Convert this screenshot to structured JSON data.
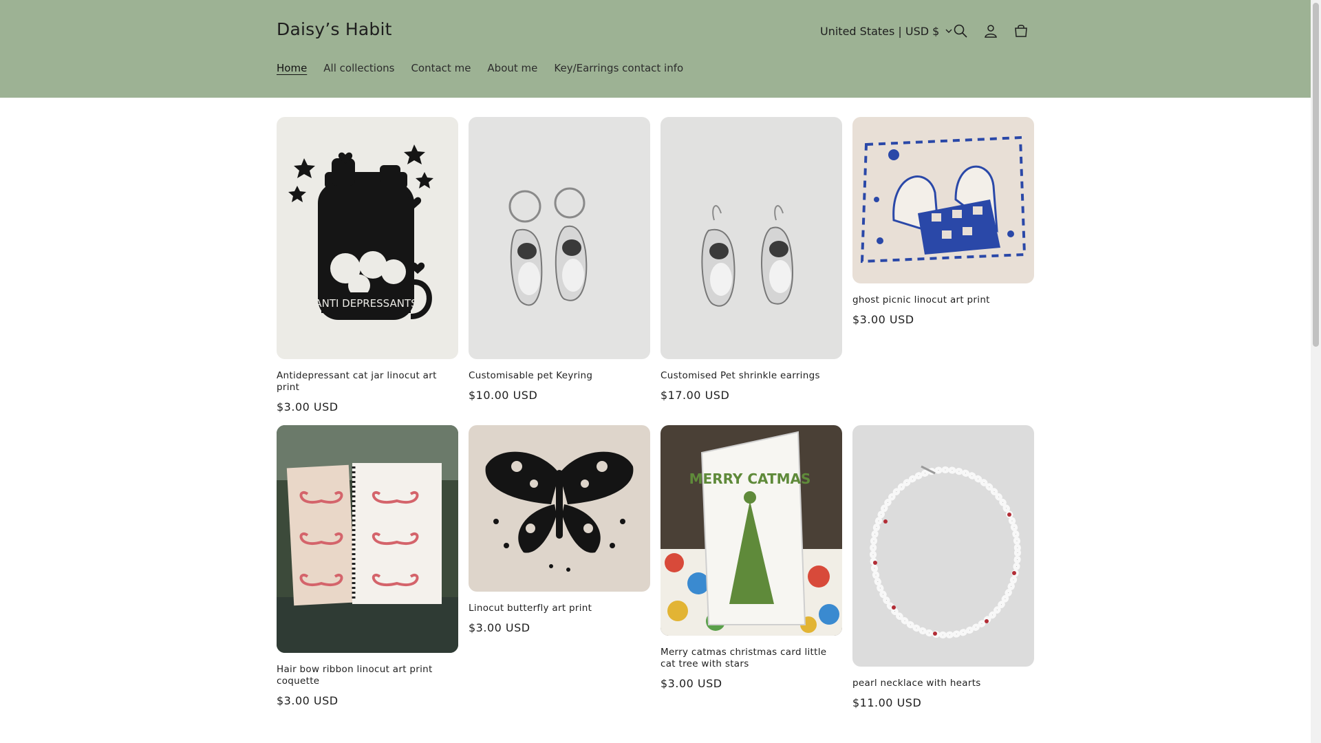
{
  "header": {
    "brand": "Daisy’s Habit",
    "country_selector": "United States | USD $",
    "nav": [
      "Home",
      "All collections",
      "Contact me",
      "About me",
      "Key/Earrings contact info"
    ],
    "icons": [
      "search-icon",
      "account-icon",
      "cart-icon"
    ],
    "bg_color": "#9db294"
  },
  "products": [
    {
      "title": "Antidepressant cat jar linocut art print",
      "price": "$3.00 USD",
      "image_text": "ANTI DEPRESSANTS"
    },
    {
      "title": "Customisable pet Keyring",
      "price": "$10.00 USD"
    },
    {
      "title": "Customised Pet shrinkle earrings",
      "price": "$17.00 USD"
    },
    {
      "title": "ghost picnic linocut art print",
      "price": "$3.00 USD"
    },
    {
      "title": "Hair bow ribbon linocut art print coquette",
      "price": "$3.00 USD"
    },
    {
      "title": "Linocut butterfly art print",
      "price": "$3.00 USD"
    },
    {
      "title": "Merry catmas christmas card little cat tree with stars",
      "price": "$3.00 USD",
      "image_text": "MERRY CATMAS"
    },
    {
      "title": "pearl necklace with hearts",
      "price": "$11.00 USD"
    }
  ]
}
